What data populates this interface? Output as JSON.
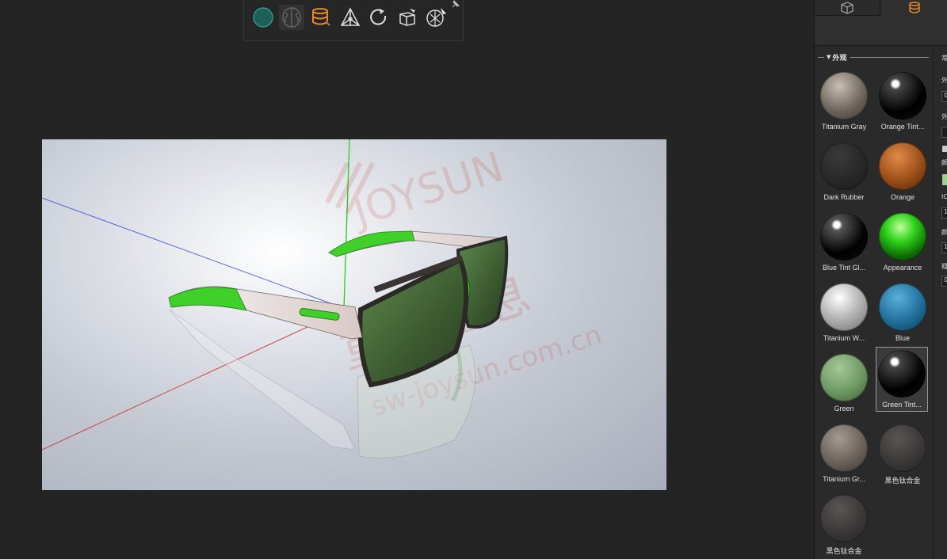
{
  "toolbar": {
    "buttons": [
      {
        "name": "appearance-sphere-icon",
        "tooltip": ""
      },
      {
        "name": "decals-icon",
        "tooltip": ""
      },
      {
        "name": "material-library-icon",
        "tooltip": ""
      },
      {
        "name": "scene-icon",
        "tooltip": ""
      },
      {
        "name": "rotate-icon",
        "tooltip": ""
      },
      {
        "name": "camera-icon",
        "tooltip": ""
      },
      {
        "name": "render-icon",
        "tooltip": ""
      }
    ],
    "pin_icon": "pin-icon"
  },
  "viewport": {
    "watermark_brand": "JOYSUN",
    "watermark_cn": "重庆信息",
    "watermark_url": "sw-joysun.com.cn"
  },
  "panel": {
    "tabs": [
      {
        "icon": "cube-icon"
      },
      {
        "icon": "database-icon",
        "color": "#e8882a"
      }
    ],
    "section_title": "外观",
    "materials": [
      {
        "label": "Titanium Gray"
      },
      {
        "label": "Orange Tint..."
      },
      {
        "label": "Dark Rubber"
      },
      {
        "label": "Orange"
      },
      {
        "label": "Blue Tint Gl..."
      },
      {
        "label": "Appearance"
      },
      {
        "label": "Titanium W..."
      },
      {
        "label": "Blue"
      },
      {
        "label": "Green"
      },
      {
        "label": "Green Tint...",
        "selected": true
      },
      {
        "label": "Titanium Gr..."
      },
      {
        "label": "黑色钛合金"
      },
      {
        "label": "黑色钛合金"
      }
    ],
    "props": {
      "labels": [
        "常",
        "外",
        "外",
        "颜",
        "IO",
        "颜",
        "粗"
      ],
      "values": [
        "0",
        "1",
        "1",
        "0"
      ]
    }
  },
  "colors": {
    "accent": "#e8882a",
    "lime": "#44d62c"
  }
}
